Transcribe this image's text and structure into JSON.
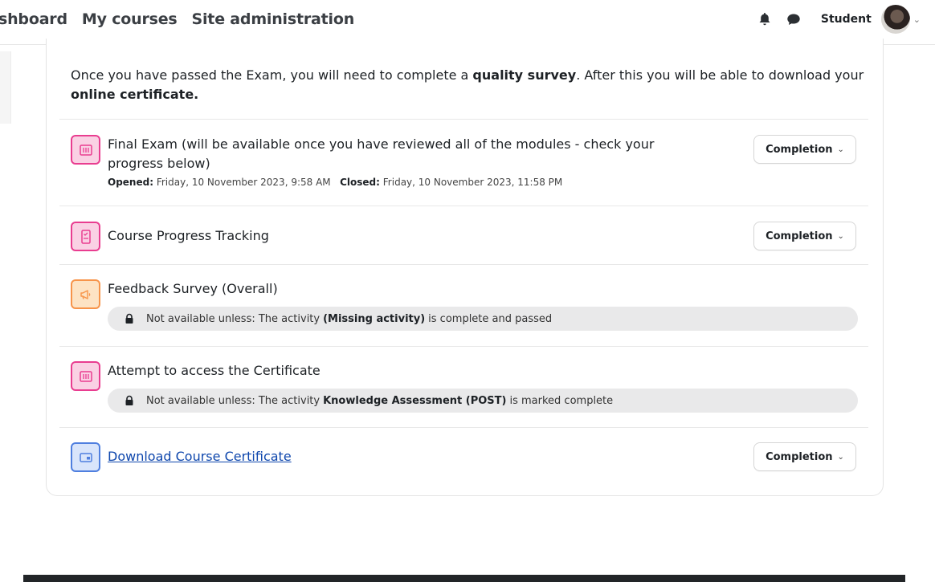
{
  "nav": {
    "links": [
      "shboard",
      "My courses",
      "Site administration"
    ],
    "user": "Student"
  },
  "intro": {
    "prefix": "Once you have passed the Exam, you will need to complete a ",
    "bold1": "quality survey",
    "middle": ". After this you will be able to download your ",
    "bold2": "online certificate."
  },
  "activities": [
    {
      "title_line1": "Final Exam (will be available once you have reviewed all of the modules - check your",
      "title_line2": "progress below)",
      "opened_label": "Opened:",
      "opened_value": "Friday, 10 November 2023, 9:58 AM",
      "closed_label": "Closed:",
      "closed_value": "Friday, 10 November 2023, 11:58 PM",
      "completion": "Completion"
    },
    {
      "title": "Course Progress Tracking",
      "completion": "Completion"
    },
    {
      "title": "Feedback Survey (Overall)",
      "restriction_prefix": "Not available unless: The activity",
      "restriction_bold": "(Missing activity)",
      "restriction_suffix": "is complete and passed"
    },
    {
      "title": "Attempt to access the Certificate",
      "restriction_prefix": "Not available unless: The activity",
      "restriction_bold": "Knowledge Assessment (POST)",
      "restriction_suffix": "is marked complete"
    },
    {
      "title": "Download Course Certificate",
      "completion": "Completion"
    }
  ],
  "colors": {
    "assessment_pink": "#e93d90",
    "communication_orange": "#f7944a",
    "resource_blue": "#4f7fdf",
    "link": "#0f47ad"
  },
  "icons": {
    "notifications": "bell-icon",
    "messages": "chat-bubble-icon",
    "restriction": "lock-icon"
  }
}
